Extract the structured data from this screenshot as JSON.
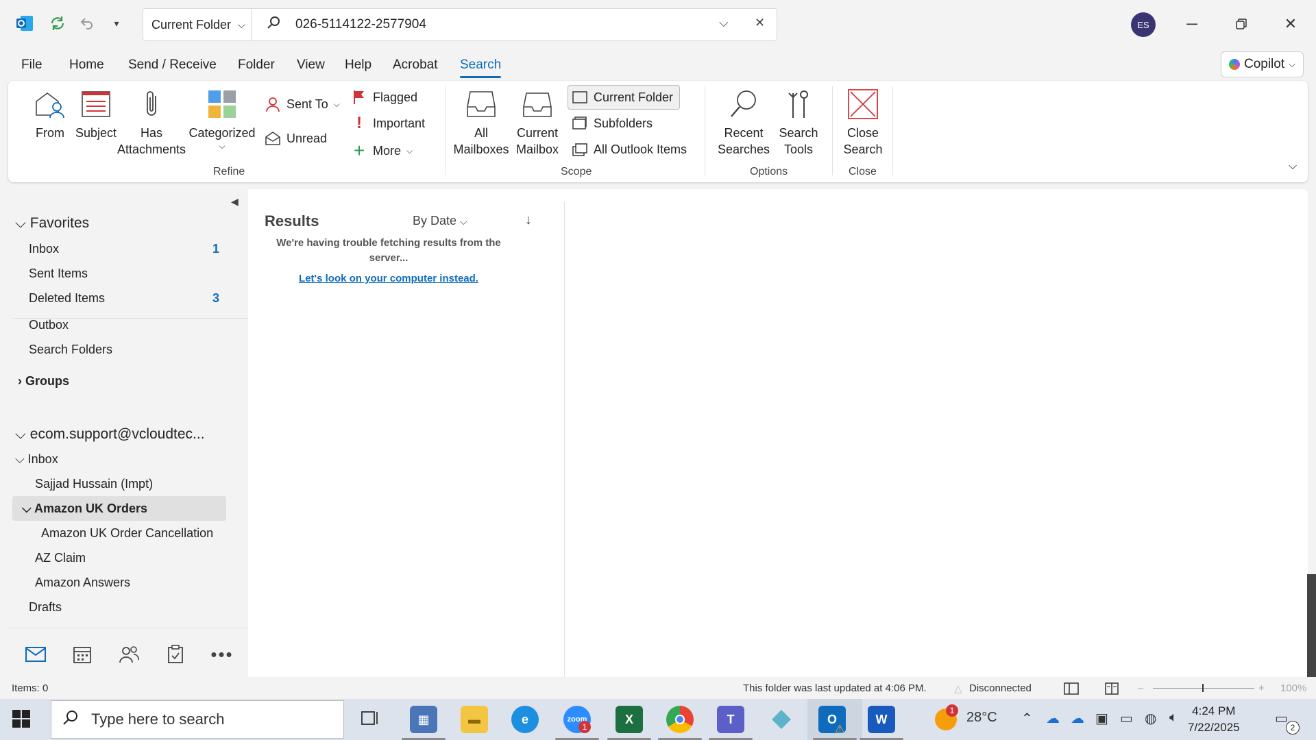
{
  "titlebar": {
    "scope": "Current Folder",
    "search_value": "026-5114122-2577904",
    "avatar_initials": "ES"
  },
  "menu": {
    "tabs": [
      "File",
      "Home",
      "Send / Receive",
      "Folder",
      "View",
      "Help",
      "Acrobat",
      "Search"
    ],
    "active": "Search",
    "copilot": "Copilot"
  },
  "ribbon": {
    "refine": {
      "from": "From",
      "subject": "Subject",
      "has_attachments_1": "Has",
      "has_attachments_2": "Attachments",
      "categorized": "Categorized",
      "sent_to": "Sent To",
      "unread": "Unread",
      "flagged": "Flagged",
      "important": "Important",
      "more": "More",
      "label": "Refine"
    },
    "scope": {
      "all_mailboxes_1": "All",
      "all_mailboxes_2": "Mailboxes",
      "current_mailbox_1": "Current",
      "current_mailbox_2": "Mailbox",
      "current_folder": "Current Folder",
      "subfolders": "Subfolders",
      "all_outlook_items": "All Outlook Items",
      "label": "Scope"
    },
    "options": {
      "recent_searches_1": "Recent",
      "recent_searches_2": "Searches",
      "search_tools_1": "Search",
      "search_tools_2": "Tools",
      "label": "Options"
    },
    "close": {
      "close_search_1": "Close",
      "close_search_2": "Search",
      "label": "Close"
    }
  },
  "folders": {
    "favorites": "Favorites",
    "inbox": "Inbox",
    "inbox_count": "1",
    "sent_items": "Sent Items",
    "deleted_items": "Deleted Items",
    "deleted_count": "3",
    "outbox": "Outbox",
    "search_folders": "Search Folders",
    "groups": "Groups",
    "account": "ecom.support@vcloudtec...",
    "acct_inbox": "Inbox",
    "sajjad": "Sajjad Hussain (Impt)",
    "amazon_uk_orders": "Amazon UK Orders",
    "amazon_uk_cancel": "Amazon UK Order Cancellation",
    "az_claim": "AZ Claim",
    "amazon_answers": "Amazon Answers",
    "drafts": "Drafts"
  },
  "results": {
    "title": "Results",
    "sort": "By Date",
    "message": "We're having trouble fetching results from the server...",
    "link": "Let's look on your computer instead."
  },
  "status": {
    "items": "Items: 0",
    "updated": "This folder was last updated at 4:06 PM.",
    "connection": "Disconnected",
    "zoom": "100%"
  },
  "taskbar": {
    "search_placeholder": "Type here to search",
    "weather": "28°C",
    "time": "4:24 PM",
    "date": "7/22/2025",
    "notif_count": "2",
    "weather_badge": "1",
    "zoom_badge": "1"
  },
  "colors": {
    "accent": "#0f6cbd",
    "close_red": "#d13438"
  }
}
